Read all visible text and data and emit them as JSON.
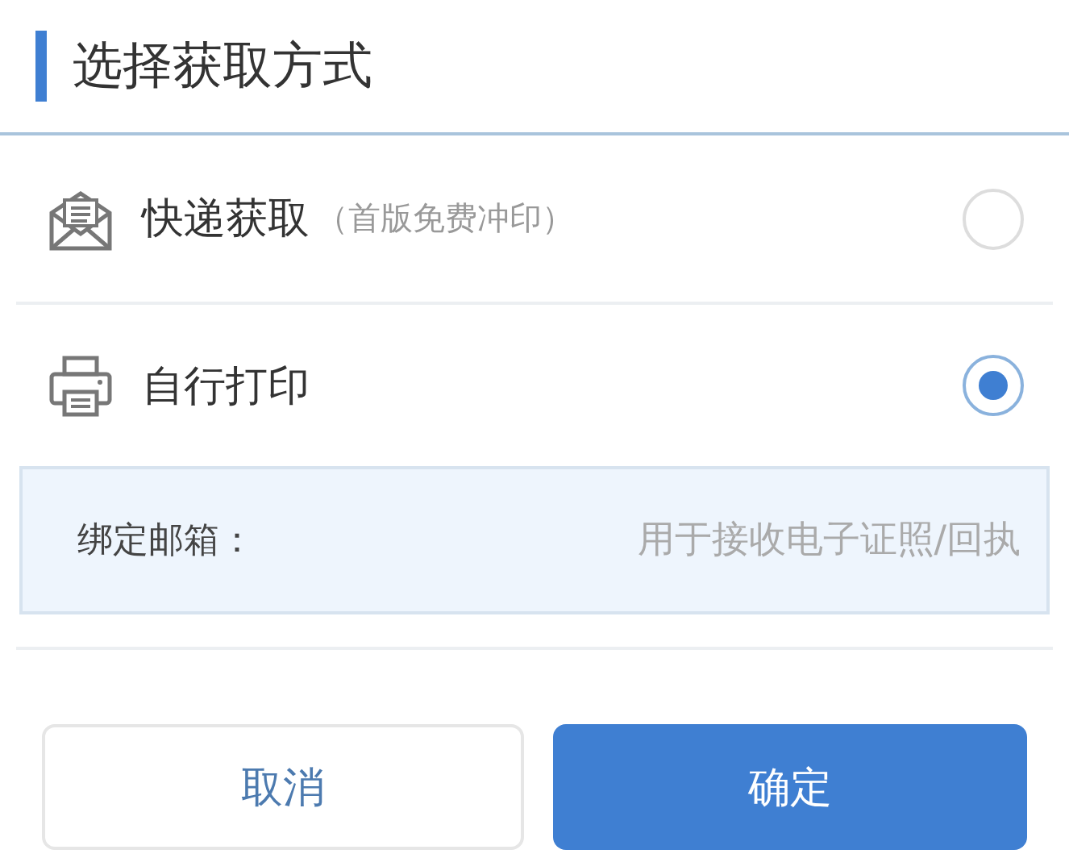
{
  "title": "选择获取方式",
  "options": [
    {
      "kind": "express",
      "label": "快递获取",
      "note": "（首版免费冲印）",
      "selected": false
    },
    {
      "kind": "print",
      "label": "自行打印",
      "selected": true
    }
  ],
  "email_field": {
    "label": "绑定邮箱：",
    "placeholder": "用于接收电子证照/回执"
  },
  "buttons": [
    {
      "kind": "secondary",
      "label": "取消"
    },
    {
      "kind": "primary",
      "label": "确定"
    }
  ]
}
